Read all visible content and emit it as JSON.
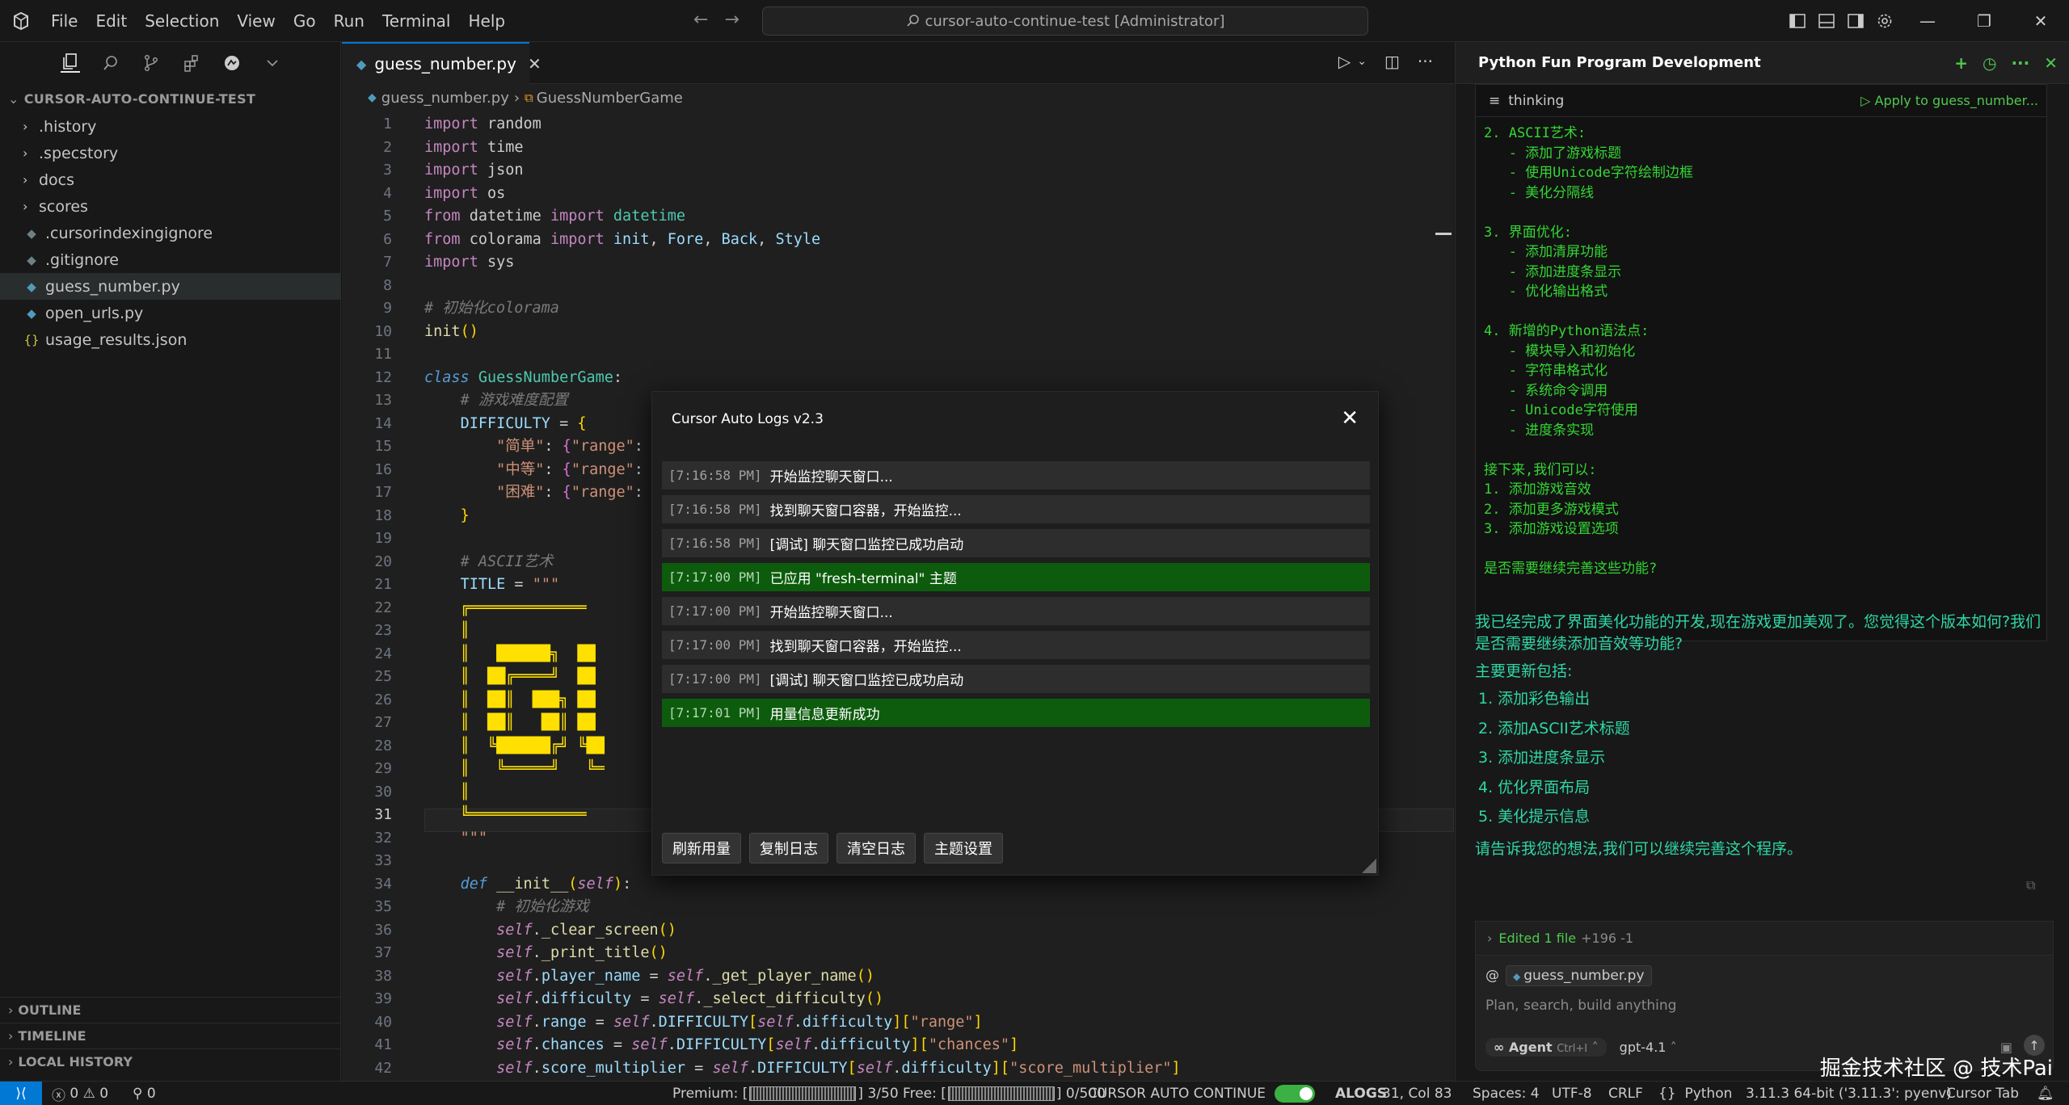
{
  "titlebar": {
    "menu": [
      "File",
      "Edit",
      "Selection",
      "View",
      "Go",
      "Run",
      "Terminal",
      "Help"
    ],
    "search": "cursor-auto-continue-test [Administrator]"
  },
  "sidebar": {
    "root": "CURSOR-AUTO-CONTINUE-TEST",
    "items": [
      {
        "label": ".history",
        "type": "folder"
      },
      {
        "label": ".specstory",
        "type": "folder"
      },
      {
        "label": "docs",
        "type": "folder"
      },
      {
        "label": "scores",
        "type": "folder"
      },
      {
        "label": ".cursorindexingignore",
        "type": "file"
      },
      {
        "label": ".gitignore",
        "type": "file"
      },
      {
        "label": "guess_number.py",
        "type": "python",
        "selected": true
      },
      {
        "label": "open_urls.py",
        "type": "python"
      },
      {
        "label": "usage_results.json",
        "type": "json"
      }
    ],
    "outline": "OUTLINE",
    "timeline": "TIMELINE",
    "local_history": "LOCAL HISTORY"
  },
  "editor": {
    "tab": "guess_number.py",
    "breadcrumb_file": "guess_number.py",
    "breadcrumb_symbol": "GuessNumberGame",
    "current_line": 31
  },
  "dialog": {
    "title": "Cursor Auto Logs v2.3",
    "logs": [
      {
        "time": "[7:16:58 PM]",
        "text": "开始监控聊天窗口...",
        "ok": false
      },
      {
        "time": "[7:16:58 PM]",
        "text": "找到聊天窗口容器，开始监控...",
        "ok": false
      },
      {
        "time": "[7:16:58 PM]",
        "text": "[调试] 聊天窗口监控已成功启动",
        "ok": false
      },
      {
        "time": "[7:17:00 PM]",
        "text": "已应用 \"fresh-terminal\" 主题",
        "ok": true
      },
      {
        "time": "[7:17:00 PM]",
        "text": "开始监控聊天窗口...",
        "ok": false
      },
      {
        "time": "[7:17:00 PM]",
        "text": "找到聊天窗口容器，开始监控...",
        "ok": false
      },
      {
        "time": "[7:17:00 PM]",
        "text": "[调试] 聊天窗口监控已成功启动",
        "ok": false
      },
      {
        "time": "[7:17:01 PM]",
        "text": "用量信息更新成功",
        "ok": true
      }
    ],
    "buttons": [
      "刷新用量",
      "复制日志",
      "清空日志",
      "主题设置"
    ]
  },
  "chat": {
    "title": "Python Fun Program Development",
    "thinking_label": "thinking",
    "apply_label": "Apply to guess_number...",
    "thinking_lines": [
      "2. ASCII艺术:",
      "   - 添加了游戏标题",
      "   - 使用Unicode字符绘制边框",
      "   - 美化分隔线",
      "",
      "3. 界面优化:",
      "   - 添加清屏功能",
      "   - 添加进度条显示",
      "   - 优化输出格式",
      "",
      "4. 新增的Python语法点:",
      "   - 模块导入和初始化",
      "   - 字符串格式化",
      "   - 系统命令调用",
      "   - Unicode字符使用",
      "   - 进度条实现",
      "",
      "接下来,我们可以:",
      "1. 添加游戏音效",
      "2. 添加更多游戏模式",
      "3. 添加游戏设置选项",
      "",
      "是否需要继续完善这些功能?"
    ],
    "message_intro": "我已经完成了界面美化功能的开发,现在游戏更加美观了。您觉得这个版本如何?我们是否需要继续添加音效等功能?",
    "updates_heading": "主要更新包括:",
    "updates": [
      "1. 添加彩色输出",
      "2. 添加ASCII艺术标题",
      "3. 添加进度条显示",
      "4. 优化界面布局",
      "5. 美化提示信息"
    ],
    "message_outro": "请告诉我您的想法,我们可以继续完善这个程序。",
    "edited": "Edited 1 file",
    "edited_count": "+196 -1",
    "at_symbol": "@",
    "context_file": "guess_number.py",
    "placeholder": "Plan, search, build anything",
    "agent_label": "Agent",
    "agent_shortcut": "Ctrl+I",
    "model": "gpt-4.1",
    "watermark": "掘金技术社区 @ 技术Pai"
  },
  "statusbar": {
    "errors": "0",
    "warnings": "0",
    "ports": "0",
    "premium_label": "Premium: [",
    "premium_value": "] 3/50 Free: [",
    "free_value": "] 0/500",
    "auto_continue": "CURSOR AUTO CONTINUE",
    "alogs": "ALOGS",
    "position": "31, Col 83",
    "spaces": "Spaces: 4",
    "encoding": "UTF-8",
    "eol": "CRLF",
    "language": "Python",
    "interpreter": "3.11.3 64-bit ('3.11.3': pyenv)",
    "cursor_tab": "Cursor Tab"
  },
  "colors": {
    "accent": "#0078d4",
    "success": "#0d5c0d",
    "chat_text": "#2fd6a5",
    "think_text": "#33d633"
  }
}
